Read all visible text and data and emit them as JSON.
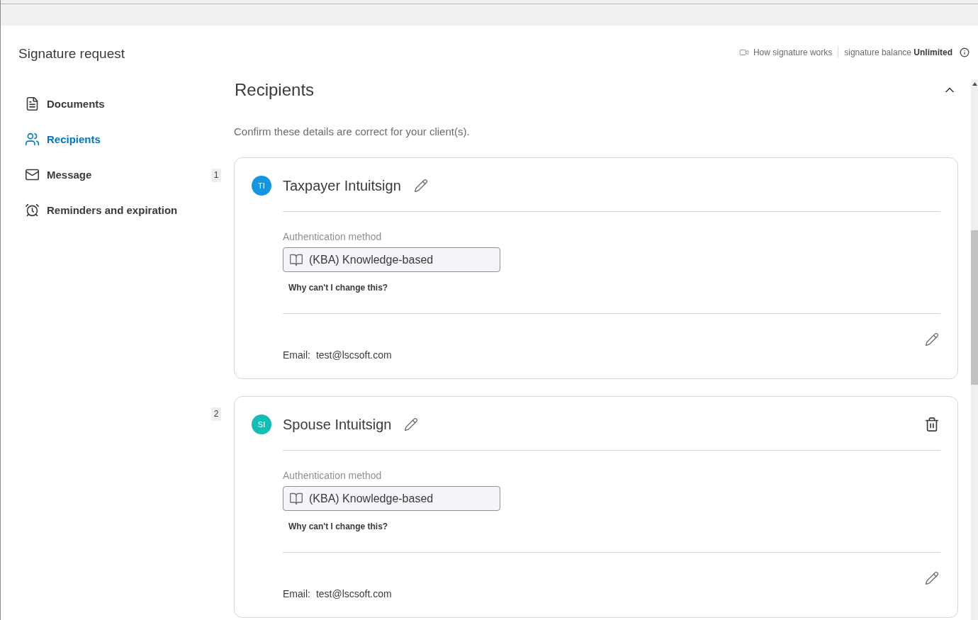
{
  "header": {
    "title": "Signature request",
    "help_link": "How signature works",
    "balance": "signature balance **Unlimited**"
  },
  "sidebar": {
    "items": [
      {
        "label": "Documents",
        "kind": "document",
        "selected": false
      },
      {
        "label": "Recipients",
        "kind": "people",
        "selected": true
      },
      {
        "label": "Message",
        "kind": "envelope",
        "selected": false
      },
      {
        "label": "Reminders and expiration",
        "kind": "alarm",
        "selected": false
      }
    ]
  },
  "section": {
    "title": "Recipients",
    "expanded": true,
    "subtitle": "Confirm these details are correct for your client(s).",
    "recipients": [
      {
        "number": "1",
        "initials": "TI",
        "color": "#1296e2",
        "name": "Taxpayer Intuitsign",
        "deletable": false,
        "auth_label": "Authentication method",
        "auth_value": "(KBA) Knowledge-based",
        "auth_help": "Why can't I change this?",
        "email_label": "Email:",
        "email": "test@lscsoft.com"
      },
      {
        "number": "2",
        "initials": "SI",
        "color": "#13bdb6",
        "name": "Spouse Intuitsign",
        "deletable": true,
        "auth_label": "Authentication method",
        "auth_value": "(KBA) Knowledge-based",
        "auth_help": "Why can't I change this?",
        "email_label": "Email:",
        "email": "test@lscsoft.com"
      }
    ]
  }
}
